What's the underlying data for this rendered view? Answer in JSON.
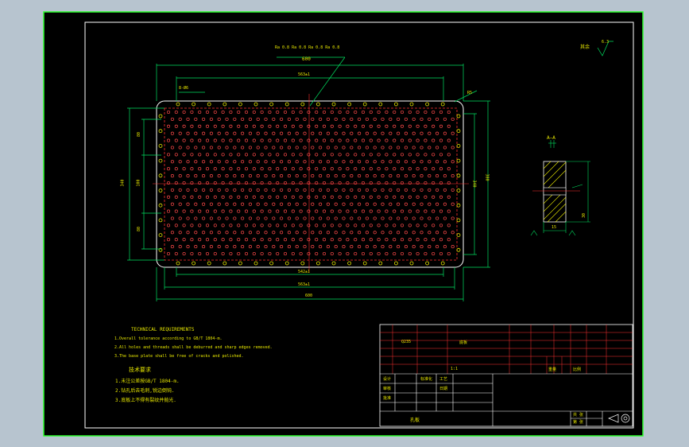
{
  "drawing": {
    "top_note": "Ra 0.8 Ra 0.8 Ra 0.8 Ra 0.8",
    "roughness_label": "其余",
    "roughness_value": "6.3",
    "dims": {
      "overall_top": "600",
      "hole_span_top": "563±1",
      "corner_callout": "8-Ø6",
      "hole_span_bottom_inner": "542±1",
      "hole_span_bottom_outer": "563±1",
      "overall_bottom": "600",
      "left_seg_top": "80",
      "left_total": "340",
      "left_seg_mid": "100",
      "left_seg_bot": "80",
      "right_inner": "340",
      "right_outer": "380",
      "right_radius": "R5",
      "section_thk": "15",
      "section_depth": "30",
      "section_title": "A—A"
    },
    "notes_en": {
      "title": "TECHNICAL REQUIREMENTS",
      "items": [
        "1.Overall tolerance according to GB/T 1804-m.",
        "2.All holes and threads shall be deburred and sharp edges removed.",
        "3.The base plate shall be free of cracks and polished."
      ]
    },
    "notes_cn": {
      "title": "技术要求",
      "items": [
        "1.未注公差按GB/T 1804-m.",
        "2.钻孔后去毛刺,锐边倒钝.",
        "3.底板上不得有裂纹并抛光."
      ]
    },
    "title_block": {
      "material": "Q235",
      "part": "底板",
      "scale": "1:1",
      "drawn": "设计",
      "check": "审核",
      "approve": "批准",
      "std": "标准化",
      "process": "工艺",
      "date": "日期",
      "sheet": "共 张",
      "sheet2": "第 张",
      "weight": "重量",
      "ratio": "比例",
      "name_bottom": "孔板"
    }
  }
}
